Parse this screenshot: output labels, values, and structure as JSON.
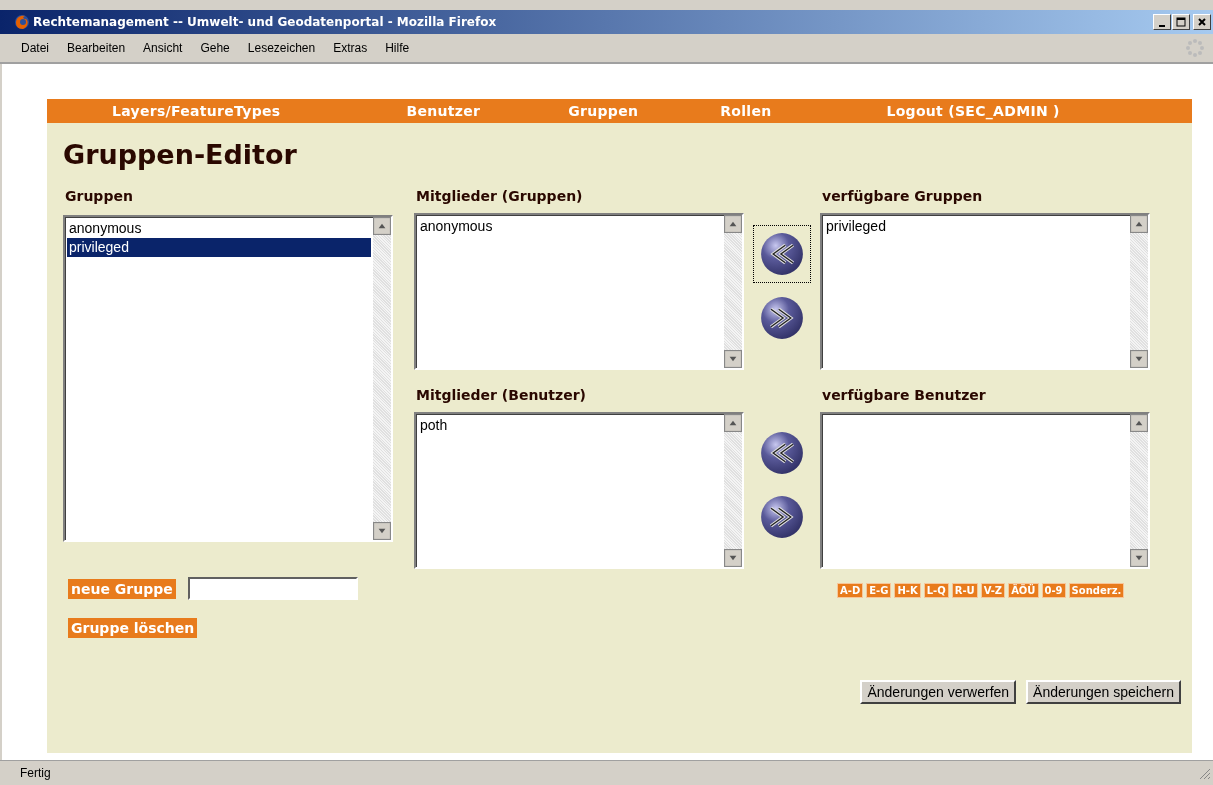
{
  "window": {
    "title": "Rechtemanagement -- Umwelt- und Geodatenportal - Mozilla Firefox"
  },
  "menu": [
    "Datei",
    "Bearbeiten",
    "Ansicht",
    "Gehe",
    "Lesezeichen",
    "Extras",
    "Hilfe"
  ],
  "nav": [
    "Layers/FeatureTypes",
    "Benutzer",
    "Gruppen",
    "Rollen",
    "Logout (SEC_ADMIN )"
  ],
  "page_title": "Gruppen-Editor",
  "groups": {
    "label": "Gruppen",
    "items": [
      {
        "text": "anonymous",
        "selected": false
      },
      {
        "text": "privileged",
        "selected": true
      }
    ]
  },
  "new_group_button": "neue Gruppe",
  "delete_group_button": "Gruppe löschen",
  "member_groups": {
    "label": "Mitglieder (Gruppen)",
    "items": [
      {
        "text": "anonymous",
        "selected": false
      }
    ]
  },
  "available_groups": {
    "label": "verfügbare Gruppen",
    "items": [
      {
        "text": "privileged",
        "selected": false
      }
    ]
  },
  "group_transfer": [
    {
      "kind": "left",
      "focused": true
    },
    {
      "kind": "right",
      "focused": false
    }
  ],
  "member_users": {
    "label": "Mitglieder (Benutzer)",
    "items": [
      {
        "text": "poth",
        "selected": false
      }
    ]
  },
  "available_users": {
    "label": "verfügbare Benutzer"
  },
  "user_transfer": [
    {
      "kind": "left",
      "focused": false
    },
    {
      "kind": "right",
      "focused": false
    }
  ],
  "letter_filters": [
    "A-D",
    "E-G",
    "H-K",
    "L-Q",
    "R-U",
    "V-Z",
    "ÄÖÜ",
    "0-9",
    "Sonderz."
  ],
  "buttons": [
    "Änderungen verwerfen",
    "Änderungen speichern"
  ],
  "status_bar": "Fertig"
}
